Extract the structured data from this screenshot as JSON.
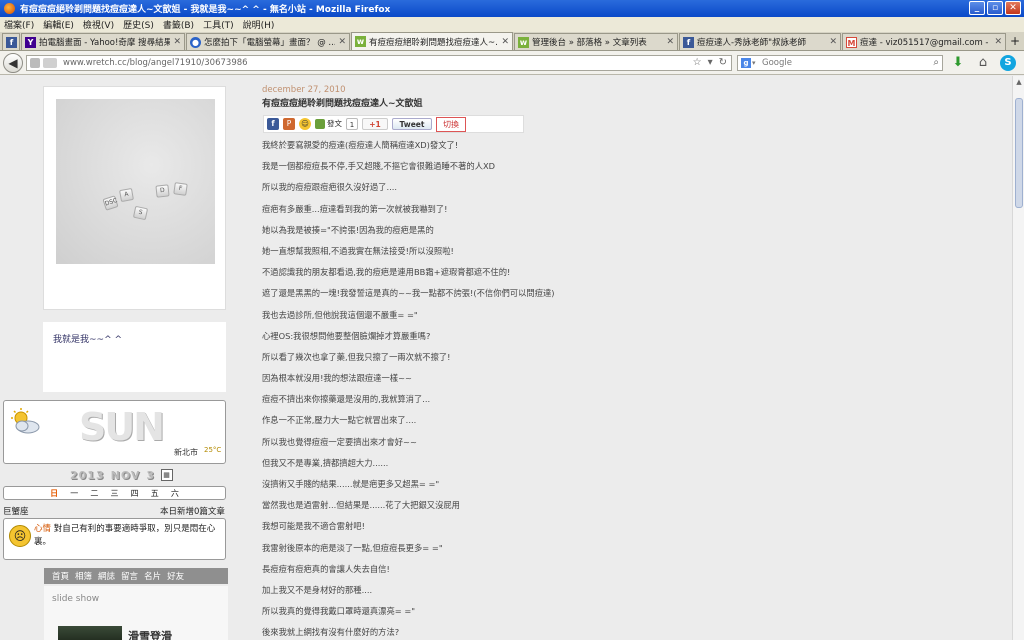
{
  "window": {
    "title": "有痘痘痘絕聆剃問題找痘痘達人~文歆姐 - 我就是我~~^ ^ - 無名小站 - Mozilla Firefox",
    "min": "_",
    "max": "▫",
    "close": "✕"
  },
  "menu": [
    "檔案(F)",
    "編輯(E)",
    "檢視(V)",
    "歷史(S)",
    "書籤(B)",
    "工具(T)",
    "說明(H)"
  ],
  "tabs": [
    {
      "icon": "facebook-icon",
      "label": "",
      "color": "#3b5998",
      "glyph": "f"
    },
    {
      "icon": "yahoo-icon",
      "label": "拍電腦畫面 - Yahoo!奇摩 搜尋結果",
      "color": "#400090",
      "glyph": "Y"
    },
    {
      "icon": "blog-icon",
      "label": "怎麼拍下「電腦螢幕」畫面？ @ ...",
      "color": "#2b63c8",
      "glyph": "●"
    },
    {
      "icon": "wretch-icon",
      "label": "有痘痘痘絕聆剃問題找痘痘達人~...",
      "color": "#7bb13c",
      "glyph": "w",
      "active": true
    },
    {
      "icon": "wretch-icon",
      "label": "管理後台 » 部落格 » 文章列表",
      "color": "#7bb13c",
      "glyph": "w"
    },
    {
      "icon": "facebook-icon",
      "label": "痘痘達人-秀詠老師\"叔詠老師",
      "color": "#3b5998",
      "glyph": "f"
    },
    {
      "icon": "gmail-icon",
      "label": "痘達 - viz051517@gmail.com - Gmail",
      "color": "#d64a3a",
      "glyph": "M"
    }
  ],
  "tab_new": "+",
  "nav": {
    "back": "◀",
    "url": "www.wretch.cc/blog/angel71910/30673986",
    "search_placeholder": "Google",
    "search_engine": "g",
    "download": "⬇",
    "home": "⌂",
    "skype": "S"
  },
  "sidebar": {
    "photo_keys": [
      "DSC",
      "A",
      "S",
      "D",
      "F"
    ],
    "intro": "我就是我~~^ ^",
    "weather": {
      "word": "SUN",
      "city": "新北市",
      "temp": "25°C"
    },
    "date": {
      "year": "2013",
      "month": "NOV",
      "day": "3"
    },
    "calendar_glyph": "▦",
    "weekdays": [
      {
        "label": "日",
        "today": true
      },
      {
        "label": "一"
      },
      {
        "label": "二"
      },
      {
        "label": "三"
      },
      {
        "label": "四"
      },
      {
        "label": "五"
      },
      {
        "label": "六"
      }
    ],
    "zodiac": "巨蟹座",
    "new_posts": "本日新增0篇文章",
    "mood_label": "心情",
    "mood_text": "對自己有利的事要適時爭取，別只是悶在心裏。",
    "links": [
      "首頁",
      "相簿",
      "網誌",
      "留言",
      "名片",
      "好友"
    ],
    "slideshow_title": "slide show",
    "slideshow_caption": "滑雪登滑"
  },
  "post": {
    "date": "december 27, 2010",
    "title": "有痘痘痘絕聆剃問題找痘痘達人~文歆姐",
    "share": {
      "fb": "f",
      "plurk": "P",
      "emoji": "☺",
      "post_label": "發文",
      "count": "1",
      "gplus": "+1",
      "tweet": "Tweet",
      "switch": "切換"
    },
    "lines": [
      "我終於要寫親愛的痘達(痘痘達人簡稱痘達XD)發文了!",
      "我是一個都痘痘長不停,手又超賤,不摳它會很難過睡不著的人XD",
      "所以我的痘痘跟痘疤很久沒好過了....",
      "痘疤有多嚴重...痘達看到我的第一次就被我嚇到了!",
      "她以為我是被揍=\"不誇張!因為我的痘疤是黑的",
      "她一直想幫我照相,不過我實在無法接受!所以沒照啦!",
      "不過認識我的朋友都看過,我的痘疤是連用BB霜+遮瑕膏都遮不住的!",
      "遮了還是黑黑的一塊!我發誓這是真的~~我一點都不誇張!(不信你們可以問痘達)",
      "我也去過診所,但他說我這個還不嚴重= =\"",
      "心裡OS:我很想問他要整個臉爛掉才算嚴重嗎?",
      "所以看了幾次也拿了藥,但我只擦了一兩次就不擦了!",
      "因為根本就沒用!我的想法跟痘達一樣~~",
      "痘痘不擠出來你擦藥還是沒用的,我就算消了...",
      "作息一不正常,壓力大一點它就冒出來了....",
      "所以我也覺得痘痘一定要擠出來才會好~~",
      "但我又不是專業,擠都擠超大力......",
      "沒擠術又手賤的結果......就是疤更多又超黑= =\"",
      "當然我也是過雷射...但結果是......花了大把銀又沒屁用",
      "我想可能是我不適合雷射吧!",
      "我雷射後原本的疤是淡了一點,但痘痘長更多= =\"",
      "長痘痘有痘疤真的會讓人失去自信!",
      "加上我又不是身材好的那種....",
      "所以我真的覺得我戴口罩時還真漂亮= =\"",
      "後來我就上網找有沒有什麼好的方法?"
    ]
  }
}
